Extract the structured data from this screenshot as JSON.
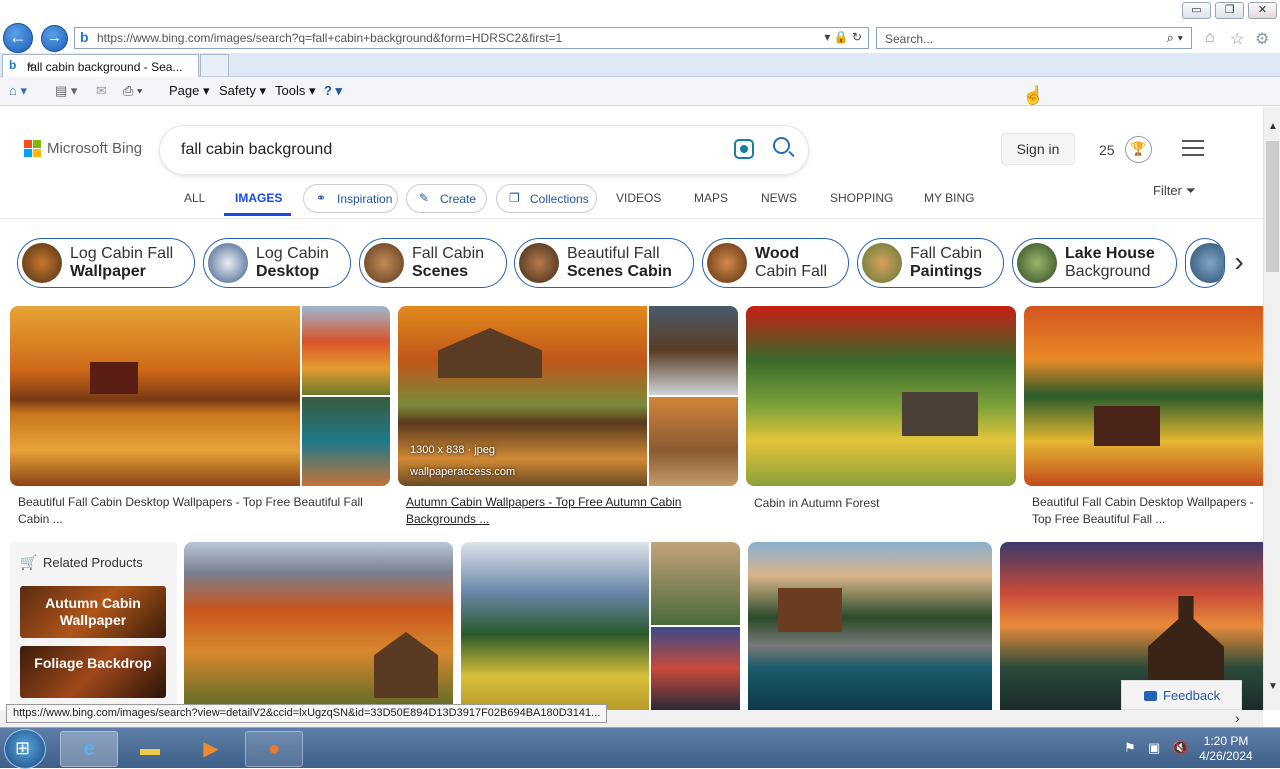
{
  "browser": {
    "url": "https://www.bing.com/images/search?q=fall+cabin+background&form=HDRSC2&first=1",
    "search_placeholder": "Search...",
    "tab_title": "fall cabin background - Sea...",
    "tab_close": "×",
    "menu": {
      "page": "Page ▾",
      "safety": "Safety ▾",
      "tools": "Tools ▾",
      "help": "? ▾"
    },
    "window_controls": {
      "minimize": "▭",
      "restore": "❐",
      "close": "✕"
    },
    "status_url": "https://www.bing.com/images/search?view=detailV2&ccid=lxUgzqSN&id=33D50E894D13D3917F02B694BA180D3141..."
  },
  "bing": {
    "logo_text": "Microsoft Bing",
    "query": "fall cabin background",
    "sign_in": "Sign in",
    "rewards_count": "25",
    "nav": {
      "all": "ALL",
      "images": "IMAGES",
      "inspiration": "Inspiration",
      "create": "Create",
      "collections": "Collections",
      "videos": "VIDEOS",
      "maps": "MAPS",
      "news": "NEWS",
      "shopping": "SHOPPING",
      "my_bing": "MY BING"
    },
    "filter": "Filter",
    "chips": [
      {
        "line1": "Log Cabin Fall",
        "line2": "Wallpaper"
      },
      {
        "line1": "Log Cabin",
        "line2": "Desktop"
      },
      {
        "line1": "Fall Cabin",
        "line2": "Scenes"
      },
      {
        "line1": "Beautiful Fall",
        "line2": "Scenes Cabin"
      },
      {
        "line1": "Wood",
        "line2": "Cabin Fall"
      },
      {
        "line1": "Fall Cabin",
        "line2": "Paintings"
      },
      {
        "line1": "Lake House",
        "line2": "Background"
      }
    ],
    "results": [
      {
        "caption": "Beautiful Fall Cabin Desktop Wallpapers - Top Free Beautiful Fall Cabin ..."
      },
      {
        "caption": "Autumn Cabin Wallpapers - Top Free Autumn Cabin Backgrounds ...",
        "size": "1300 x 838 · jpeg",
        "source": "wallpaperaccess.com"
      },
      {
        "caption": "Cabin in Autumn Forest"
      },
      {
        "caption": "Beautiful Fall Cabin Desktop Wallpapers - Top Free Beautiful Fall ..."
      }
    ],
    "related": {
      "heading": "Related Products",
      "items": [
        "Autumn Cabin Wallpaper",
        "Foliage Backdrop"
      ]
    },
    "feedback": "Feedback"
  },
  "taskbar": {
    "time": "1:20 PM",
    "date": "4/26/2024"
  }
}
